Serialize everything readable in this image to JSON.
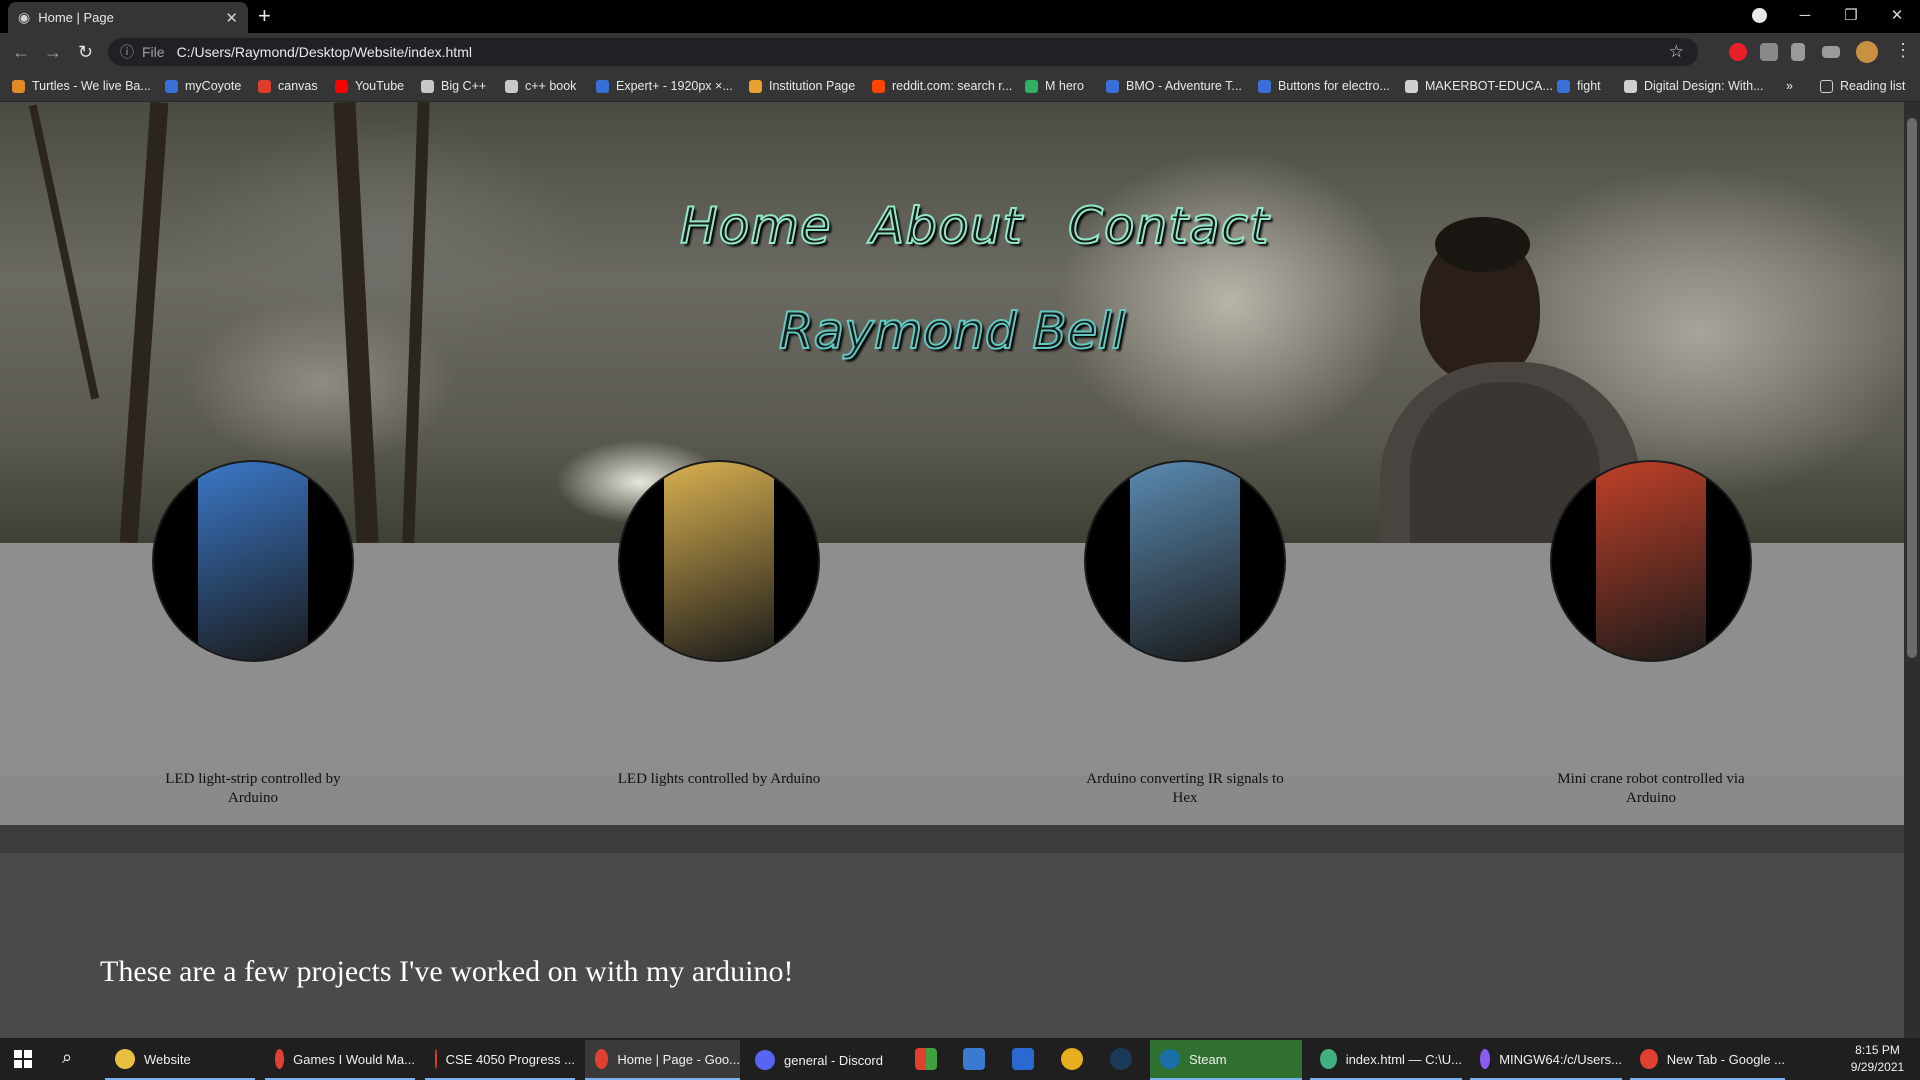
{
  "browser": {
    "tab_title": "Home | Page",
    "close": "✕",
    "new_tab": "+",
    "window_controls": {
      "minimize": "─",
      "restore": "❐",
      "close": "✕"
    },
    "omnibox": {
      "info_icon": "ⓘ",
      "scheme_label": "File",
      "url": "C:/Users/Raymond/Desktop/Website/index.html"
    },
    "nav": {
      "back": "←",
      "forward": "→",
      "reload": "↻"
    },
    "star": "☆",
    "menu": "⋮"
  },
  "bookmarks": [
    {
      "label": "Turtles - We live Ba...",
      "color": "#e08a2a"
    },
    {
      "label": "myCoyote",
      "color": "#3b6fd8"
    },
    {
      "label": "canvas",
      "color": "#e03c2c"
    },
    {
      "label": "YouTube",
      "color": "#ff0000"
    },
    {
      "label": "Big C++",
      "color": "#c8c8c8"
    },
    {
      "label": "c++ book",
      "color": "#c8c8c8"
    },
    {
      "label": "Expert+ - 1920px ×...",
      "color": "#3b6fd8"
    },
    {
      "label": "Institution Page",
      "color": "#e8a030"
    },
    {
      "label": "reddit.com: search r...",
      "color": "#ff4500"
    },
    {
      "label": "M hero",
      "color": "#30b060"
    },
    {
      "label": "BMO - Adventure T...",
      "color": "#3b6fd8"
    },
    {
      "label": "Buttons for electro...",
      "color": "#3b6fd8"
    },
    {
      "label": "MAKERBOT-EDUCA...",
      "color": "#d0d0d0"
    },
    {
      "label": "fight",
      "color": "#3b6fd8"
    },
    {
      "label": "Digital Design: With...",
      "color": "#d0d0d0"
    }
  ],
  "bookmarks_more": "»",
  "reading_list": "Reading list",
  "site": {
    "nav": [
      "Home",
      "About",
      "Contact"
    ],
    "name": "Raymond Bell",
    "projects": [
      {
        "caption": "LED light-strip controlled by Arduino",
        "tint": "#3a78c8"
      },
      {
        "caption": "LED lights controlled by Arduino",
        "tint": "#d8b050"
      },
      {
        "caption": "Arduino converting IR signals to Hex",
        "tint": "#5a8ab0"
      },
      {
        "caption": "Mini crane robot controlled via Arduino",
        "tint": "#c04028"
      }
    ],
    "blurb": "These are a few projects I've worked on with my arduino!"
  },
  "taskbar": {
    "items": [
      {
        "label": "Website",
        "color": "#e8c040"
      },
      {
        "label": "Games I Would Ma...",
        "color": "#e04030"
      },
      {
        "label": "CSE 4050 Progress ...",
        "color": "#e04030"
      },
      {
        "label": "Home | Page - Goo...",
        "color": "#e04030"
      },
      {
        "label": "general - Discord",
        "color": "#5865f2"
      },
      {
        "label": "Steam",
        "color": "#1b6fa8"
      },
      {
        "label": "index.html — C:\\U...",
        "color": "#40b080"
      },
      {
        "label": "MINGW64:/c/Users...",
        "color": "#8a5cf0"
      },
      {
        "label": "New Tab - Google ...",
        "color": "#e04030"
      }
    ],
    "time": "8:15 PM",
    "date": "9/29/2021"
  }
}
